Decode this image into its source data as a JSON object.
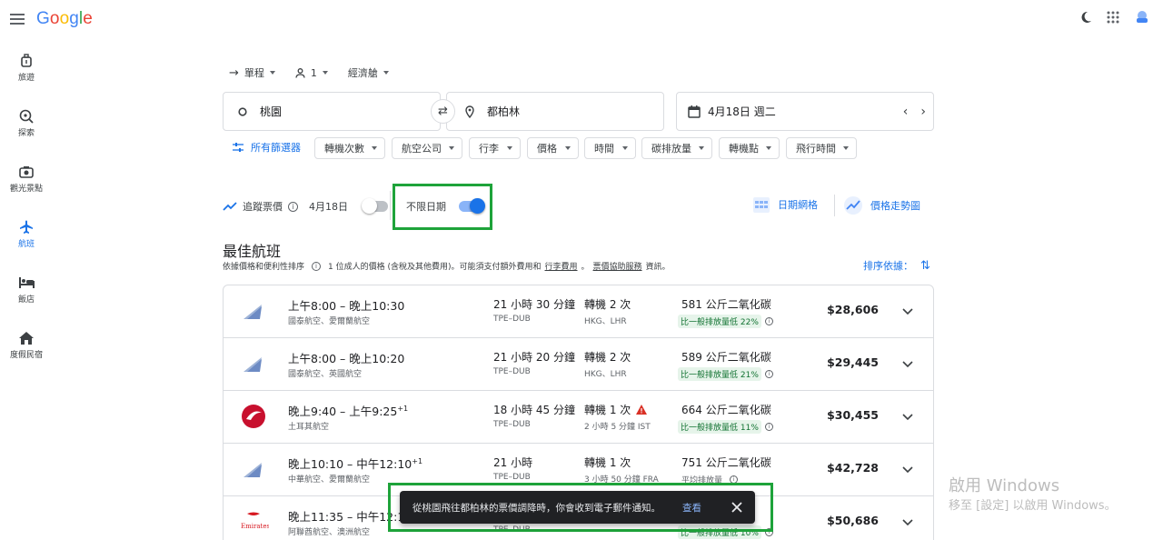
{
  "logo": "Google",
  "nav": [
    {
      "label": "旅遊",
      "icon": "suitcase-icon",
      "active": false
    },
    {
      "label": "探索",
      "icon": "explore-icon",
      "active": false
    },
    {
      "label": "觀光景點",
      "icon": "camera-icon",
      "active": false
    },
    {
      "label": "航班",
      "icon": "airplane-icon",
      "active": true
    },
    {
      "label": "飯店",
      "icon": "bed-icon",
      "active": false
    },
    {
      "label": "度假民宿",
      "icon": "home-icon",
      "active": false
    }
  ],
  "trip": {
    "type": "單程",
    "passengers": "1",
    "cabin": "經濟艙"
  },
  "search": {
    "origin": "桃園",
    "destination": "都柏林",
    "date": "4月18日 週二"
  },
  "filters": {
    "all": "所有篩選器",
    "chips": [
      "轉機次數",
      "航空公司",
      "行李",
      "價格",
      "時間",
      "碳排放量",
      "轉機點",
      "飛行時間"
    ]
  },
  "track": {
    "label": "追蹤票價",
    "date": "4月18日",
    "any_date": "不限日期"
  },
  "tools": {
    "date_grid": "日期網格",
    "price_graph": "價格走勢圖"
  },
  "best": {
    "title": "最佳航班",
    "sub_a": "依據價格和便利性排序",
    "sub_b": "1 位成人的價格 (含稅及其他費用)。可能須支付額外費用和",
    "sub_link1": "行李費用",
    "sub_c": "。",
    "sub_link2": "票價協助服務",
    "sub_d": "資訊。",
    "sort": "排序依據："
  },
  "flights": [
    {
      "time": "上午8:00 – 晚上10:30",
      "plus": "",
      "airline": "國泰航空、愛爾蘭航空",
      "duration": "21 小時 30 分鐘",
      "route": "TPE–DUB",
      "stops": "轉機 2 次",
      "warn": false,
      "stop_info": "HKG、LHR",
      "co2": "581 公斤二氧化碳",
      "co2_note": "比一般排放量低 22%",
      "co2_plain": false,
      "price": "$28,606",
      "logo": "cathay"
    },
    {
      "time": "上午8:00 – 晚上10:20",
      "plus": "",
      "airline": "國泰航空、英國航空",
      "duration": "21 小時 20 分鐘",
      "route": "TPE–DUB",
      "stops": "轉機 2 次",
      "warn": false,
      "stop_info": "HKG、LHR",
      "co2": "589 公斤二氧化碳",
      "co2_note": "比一般排放量低 21%",
      "co2_plain": false,
      "price": "$29,445",
      "logo": "cathay"
    },
    {
      "time": "晚上9:40 – 上午9:25",
      "plus": "+1",
      "airline": "土耳其航空",
      "duration": "18 小時 45 分鐘",
      "route": "TPE–DUB",
      "stops": "轉機 1 次",
      "warn": true,
      "stop_info": "2 小時 5 分鐘 IST",
      "co2": "664 公斤二氧化碳",
      "co2_note": "比一般排放量低 11%",
      "co2_plain": false,
      "price": "$30,455",
      "logo": "turkish"
    },
    {
      "time": "晚上10:10 – 中午12:10",
      "plus": "+1",
      "airline": "中華航空、愛爾蘭航空",
      "duration": "21 小時",
      "route": "TPE–DUB",
      "stops": "轉機 1 次",
      "warn": false,
      "stop_info": "3 小時 50 分鐘 FRA",
      "co2": "751 公斤二氧化碳",
      "co2_note": "平均排放量",
      "co2_plain": true,
      "price": "$42,728",
      "logo": "china"
    },
    {
      "time": "晚上11:35 – 中午12:10",
      "plus": "+1",
      "airline": "阿聯酋航空、澳洲航空",
      "duration": "",
      "route": "TPE–DUB",
      "stops": "",
      "warn": false,
      "stop_info": "",
      "co2": "",
      "co2_note": "比一般排放量低 10%",
      "co2_plain": false,
      "price": "$50,686",
      "logo": "emirates"
    }
  ],
  "snackbar": {
    "message": "從桃園飛往都柏林的票價調降時，你會收到電子郵件通知。",
    "action": "查看"
  },
  "watermark": {
    "line1": "啟用 Windows",
    "line2": "移至 [設定] 以啟用 Windows。"
  },
  "colors": {
    "accent": "#1a73e8",
    "highlight": "#1ea33a",
    "eco": "#137333"
  }
}
